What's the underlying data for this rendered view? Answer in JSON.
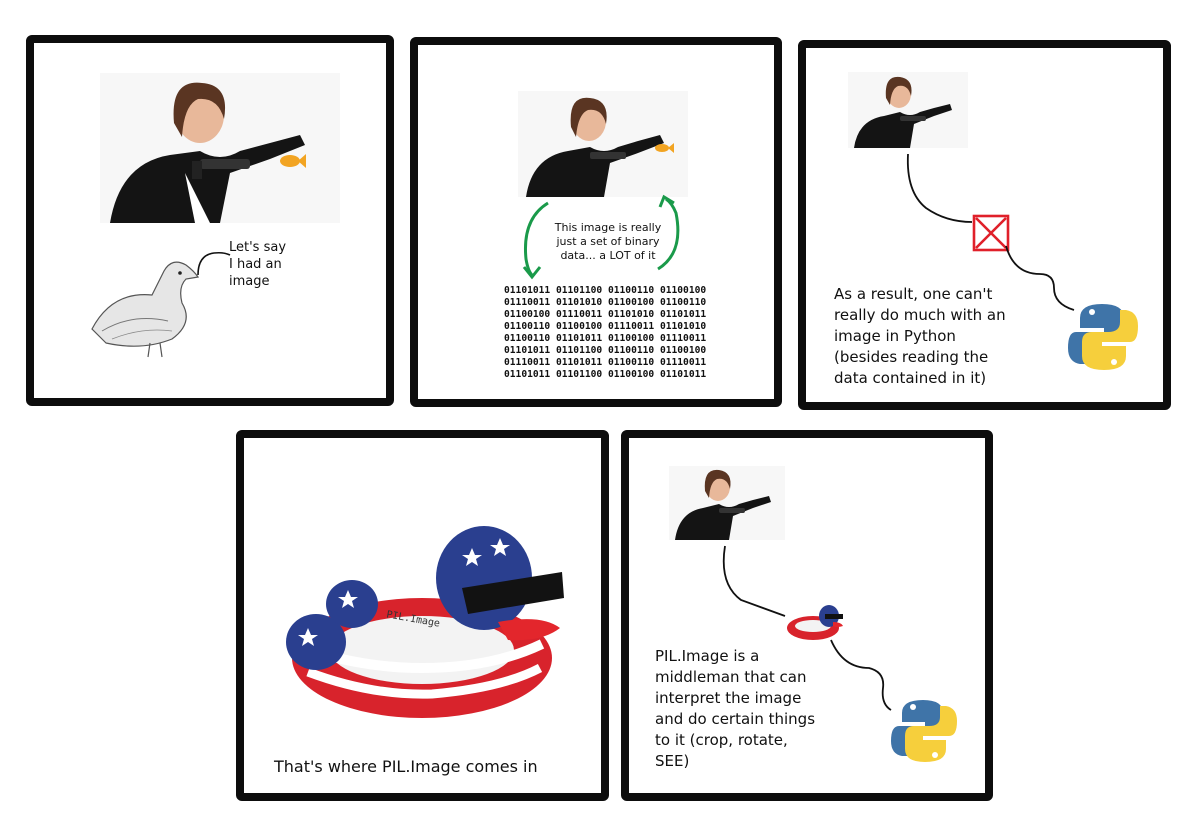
{
  "panels": [
    {
      "caption": "Let's say\nI had an\nimage"
    },
    {
      "caption": "This image is really\njust a set of binary\ndata... a LOT of it",
      "binary": "01101011 01101100 01100110 01100100\n01110011 01101010 01100100 01100110\n01100100 01110011 01101010 01101011\n01100110 01100100 01110011 01101010\n01100110 01101011 01100100 01110011\n01101011 01101100 01100110 01100100\n01110011 01101011 01100110 01110011\n01101011 01101100 01100100 01101011"
    },
    {
      "caption": "As a result, one can't\nreally do much with an\nimage in Python\n(besides reading the\ndata contained in it)"
    },
    {
      "caption": "That's where PIL.Image comes in",
      "float_label": "PIL.Image"
    },
    {
      "caption": "PIL.Image is a\nmiddleman that can\ninterpret the image\nand do certain things\nto it (crop, rotate,\nSEE)"
    }
  ],
  "colors": {
    "border": "#0d0d0d",
    "arrow_green": "#1a9a4a",
    "red_x": "#e0202a",
    "python_blue": "#3f74a8",
    "python_yellow": "#f6cf3c",
    "float_red": "#d8232c",
    "float_blue": "#2a3f8f"
  },
  "icons": [
    "woman-with-gun-icon",
    "goldfish-icon",
    "duck-sketch-icon",
    "red-x-icon",
    "python-logo-icon",
    "inflatable-duck-float-icon"
  ]
}
